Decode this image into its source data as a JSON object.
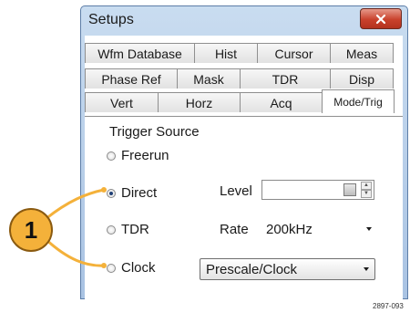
{
  "window": {
    "title": "Setups"
  },
  "tabs": {
    "row1": [
      "Wfm Database",
      "Hist",
      "Cursor",
      "Meas"
    ],
    "row2": [
      "Phase Ref",
      "Mask",
      "TDR",
      "Disp"
    ],
    "row3": [
      "Vert",
      "Horz",
      "Acq",
      "Mode/Trig"
    ]
  },
  "trigger": {
    "group_label": "Trigger Source",
    "options": [
      "Freerun",
      "Direct",
      "TDR",
      "Clock"
    ],
    "selected": "Direct"
  },
  "level": {
    "label": "Level",
    "value": ""
  },
  "rate": {
    "label": "Rate",
    "value": "200kHz"
  },
  "clock": {
    "value": "Prescale/Clock"
  },
  "callout": {
    "number": "1"
  },
  "figure_id": "2897-093",
  "icons": [
    "close-icon",
    "keypad-icon",
    "spin-up-icon",
    "spin-down-icon",
    "dropdown-arrow-icon"
  ],
  "colors": {
    "title_bar": "#b9cfea",
    "close_button": "#c9412c",
    "callout": "#f4b13a"
  }
}
